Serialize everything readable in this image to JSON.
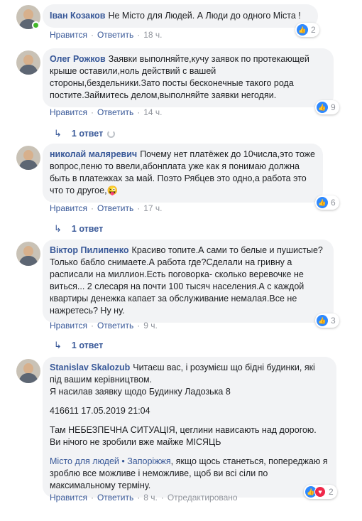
{
  "comments": [
    {
      "author": "Іван Козаков",
      "text": "Не Місто для Людей. А Люди до одного Міста !",
      "like_label": "Нравится",
      "reply_label": "Ответить",
      "time": "18 ч.",
      "reactions": "2"
    },
    {
      "author": "Олег Рожков",
      "text": "Заявки выполняйте,кучу заявок по протекающей крыше оставили,ноль действий с вашей стороны,бездельники.Зато посты бесконечные такого рода постите.Займитесь делом,выполняйте заявки негодяи.",
      "like_label": "Нравится",
      "reply_label": "Ответить",
      "time": "14 ч.",
      "reactions": "9",
      "replies": "1 ответ"
    },
    {
      "author": "николай маляревич",
      "text": "Почему нет платёжек до 10числа,это тоже вопрос,пеню то ввели,абонплата уже как я понимаю должна быть в платежках за май. Поэто Рябцев это одно,а работа это что то другое,😜",
      "like_label": "Нравится",
      "reply_label": "Ответить",
      "time": "17 ч.",
      "reactions": "6",
      "replies": "1 ответ"
    },
    {
      "author": "Віктор Пилипенко",
      "text": "Красиво топите.А сами то белые и пушистые?Только бабло снимаете.А работа где?Сделали на гривну а расписали на миллион.Есть поговорка- сколько веревочке не виться... 2 слесаря на почти 100 тысяч населения.А с каждой квартиры денежка капает за обслуживание немалая.Все не нажретесь? Ну ну.",
      "like_label": "Нравится",
      "reply_label": "Ответить",
      "time": "9 ч.",
      "reactions": "3",
      "replies": "1 ответ"
    },
    {
      "author": "Stanislav Skalozub",
      "text_p1": "Читаєш вас, і розумієш що бідні будинки, які під вашим керівництвом.",
      "text_p2": "Я насилав заявку щодо Будинку Ладозька 8",
      "text_p3": "416611 17.05.2019 21:04",
      "text_p4": "Там НЕБЕЗПЕЧНА СИТУАЦІЯ, цеглини нависають над дорогою. Ви нічого не зробили вже майже МІСЯЦЬ",
      "mention": "Місто для людей • Запоріжжя",
      "text_p5": ", якщо щось станеться, попереджаю я зроблю все можливе і неможливе, щоб ви всі сіли по максимальному терміну.",
      "like_label": "Нравится",
      "reply_label": "Ответить",
      "time": "8 ч.",
      "edited": "Отредактировано",
      "reactions": "2"
    }
  ],
  "colors": {
    "link": "#385898",
    "bubble": "#f2f3f5",
    "meta": "#90949c",
    "like": "#2e89ff",
    "love": "#f0284a"
  },
  "icons": [
    "like-icon",
    "love-icon",
    "reply-arrow-icon",
    "loading-spinner-icon"
  ]
}
